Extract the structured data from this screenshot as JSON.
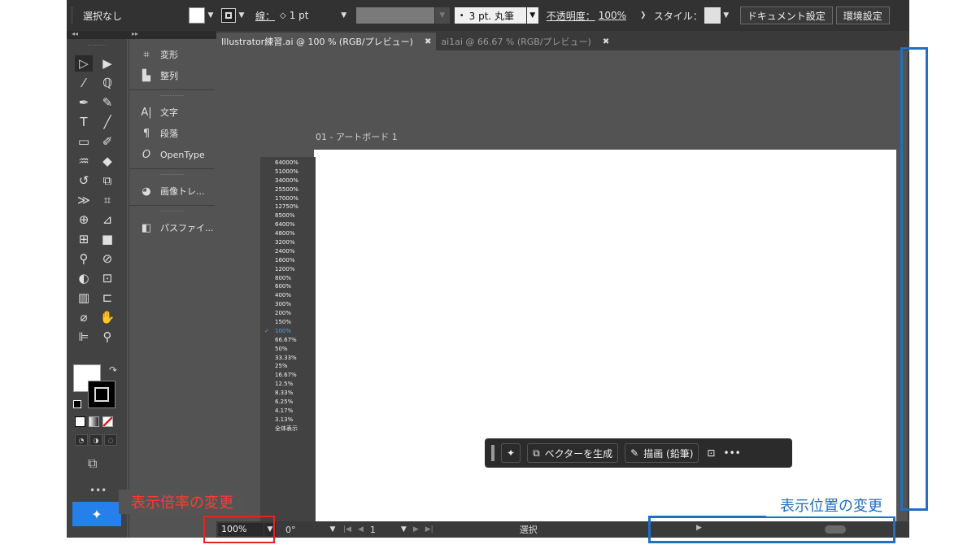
{
  "control_bar": {
    "selection": "選択なし",
    "stroke_label": "線：",
    "stroke_value": "1 pt",
    "brush": "3 pt. 丸筆",
    "opacity_label": "不透明度：",
    "opacity_value": "100%",
    "style_label": "スタイル：",
    "doc_setup": "ドキュメント設定",
    "prefs": "環境設定",
    "fill_color": "#ffffff"
  },
  "panels": {
    "items": [
      {
        "icon": "transform-icon",
        "glyph": "⌗",
        "label": "変形"
      },
      {
        "icon": "align-icon",
        "glyph": "▙",
        "label": "整列"
      },
      {
        "icon": "character-icon",
        "glyph": "A|",
        "label": "文字"
      },
      {
        "icon": "paragraph-icon",
        "glyph": "¶",
        "label": "段落"
      },
      {
        "icon": "opentype-icon",
        "glyph": "O",
        "label": "OpenType"
      },
      {
        "icon": "image-trace-icon",
        "glyph": "◕",
        "label": "画像トレ..."
      },
      {
        "icon": "pathfinder-icon",
        "glyph": "◧",
        "label": "パスファイ..."
      }
    ]
  },
  "tabs": [
    {
      "label": "Illustrator練習.ai @ 100 % (RGB/プレビュー)",
      "close": "✖",
      "active": true
    },
    {
      "label": "ai1ai @ 66.67 % (RGB/プレビュー)",
      "close": "✖",
      "active": false
    }
  ],
  "artboard_label": "01 - アートボード 1",
  "zoom_levels": [
    "64000%",
    "51000%",
    "34000%",
    "25500%",
    "17000%",
    "12750%",
    "8500%",
    "6400%",
    "4800%",
    "3200%",
    "2400%",
    "1600%",
    "1200%",
    "800%",
    "600%",
    "400%",
    "300%",
    "200%",
    "150%",
    "100%",
    "66.67%",
    "50%",
    "33.33%",
    "25%",
    "16.67%",
    "12.5%",
    "8.33%",
    "6.25%",
    "4.17%",
    "3.13%",
    "全体表示"
  ],
  "zoom_current": "100%",
  "taskbar": {
    "generate_vector": "ベクターを生成",
    "draw_pencil": "描画 (鉛筆)",
    "more": "•••"
  },
  "status": {
    "zoom": "100%",
    "rotation": "0°",
    "page": "1",
    "tool": "選択"
  },
  "annotations": {
    "zoom_change": "表示倍率の変更",
    "position_change": "表示位置の変更",
    "red": "#e8231c",
    "blue": "#1f6fc2"
  }
}
